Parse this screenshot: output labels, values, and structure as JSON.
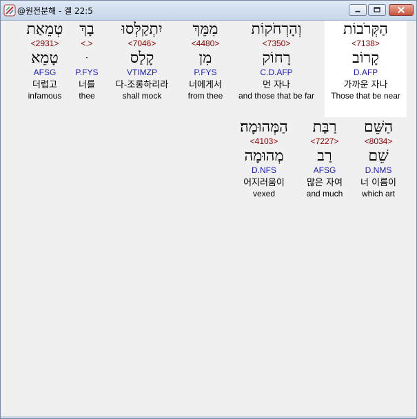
{
  "window": {
    "title": "@원전분해 - 겔 22:5"
  },
  "words_row1": [
    {
      "hebrew": "הַקְּרֹבוֹת",
      "strong": "<7138>",
      "root": "קָרוֹב",
      "morph": "D.AFP",
      "korean": "가까운 자나",
      "english": "Those that be near",
      "highlighted": true
    },
    {
      "hebrew": "וְהָרְחֹקוֹת",
      "strong": "<7350>",
      "root": "רָחוֹק",
      "morph": "C.D.AFP",
      "korean": "먼 자나",
      "english": "and those that be far",
      "highlighted": false
    },
    {
      "hebrew": "מִמֵּךְ",
      "strong": "<4480>",
      "root": "מִן",
      "morph": "P.FYS",
      "korean": "너에게서",
      "english": "from thee",
      "highlighted": false
    },
    {
      "hebrew": "יִתְקַלְּסוּ",
      "strong": "<7046>",
      "root": "קָלַס",
      "morph": "VTIMZP",
      "korean": "다-조롱하리라",
      "english": "shall mock",
      "highlighted": false
    },
    {
      "hebrew": "בָךְ",
      "strong": "<.>",
      "root": "ּ",
      "morph": "P.FYS",
      "korean": "너를",
      "english": "thee",
      "highlighted": false
    },
    {
      "hebrew": "טְמֵאַת",
      "strong": "<2931>",
      "root": "טָמֵא",
      "morph": "AFSG",
      "korean": "더럽고",
      "english": "infamous",
      "highlighted": false
    }
  ],
  "words_row2": [
    {
      "hebrew": "הַשֵּׁם",
      "strong": "<8034>",
      "root": "שֵׁם",
      "morph": "D.NMS",
      "korean": "너 이름이",
      "english": "which art"
    },
    {
      "hebrew": "רַבַּת",
      "strong": "<7227>",
      "root": "רַב",
      "morph": "AFSG",
      "korean": "많은 자여",
      "english": "and much"
    },
    {
      "hebrew": "הַמְּהוּמָה׃",
      "strong": "<4103>",
      "root": "מְהוּמָה",
      "morph": "D.NFS",
      "korean": "어지러움이",
      "english": "vexed"
    }
  ]
}
